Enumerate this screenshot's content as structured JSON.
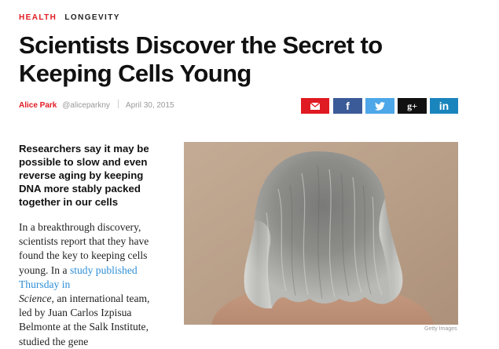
{
  "kicker": {
    "section": "HEALTH",
    "subsection": "LONGEVITY"
  },
  "headline": "Scientists Discover the Secret to Keeping Cells Young",
  "byline": {
    "author": "Alice Park",
    "handle": "@aliceparkny",
    "date": "April 30, 2015"
  },
  "share": {
    "buttons": [
      {
        "network": "email",
        "icon": "envelope-icon",
        "color": "#e01a22"
      },
      {
        "network": "facebook",
        "icon": "facebook-icon",
        "glyph": "f",
        "color": "#3b5a98"
      },
      {
        "network": "twitter",
        "icon": "twitter-bird-icon",
        "color": "#4da7e8"
      },
      {
        "network": "google-plus",
        "icon": "google-plus-icon",
        "glyph": "g+",
        "color": "#111111"
      },
      {
        "network": "linkedin",
        "icon": "linkedin-icon",
        "glyph": "in",
        "color": "#1a84bc"
      }
    ]
  },
  "dek": "Researchers say it may be possible to slow and even reverse aging by keeping DNA more stably packed together in our cells",
  "body": {
    "p1": "In a breakthrough discovery, scientists report that they have found the key to keeping cells young. In a ",
    "link": "study published Thursday in",
    "journal": "Science",
    "p2": ", an international team, led by Juan Carlos Izpisua Belmonte at the Salk Institute, studied the gene"
  },
  "photo": {
    "subject": "back-of-head-gray-hair-photo",
    "credit": "Getty Images"
  },
  "colors": {
    "accent": "#e01a22",
    "link": "#2e8fd6"
  }
}
